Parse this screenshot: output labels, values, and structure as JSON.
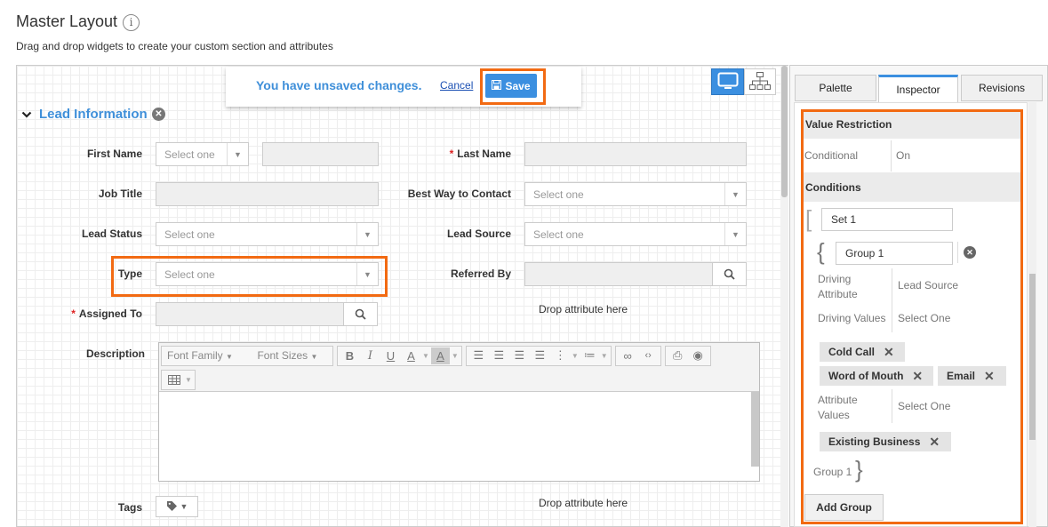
{
  "page": {
    "title": "Master Layout",
    "info_icon": "i",
    "subtitle": "Drag and drop widgets to create your custom section and attributes"
  },
  "notice": {
    "message": "You have unsaved changes.",
    "cancel_label": "Cancel",
    "save_label": "Save"
  },
  "section": {
    "title": "Lead Information"
  },
  "fields": {
    "first_name": {
      "label": "First Name",
      "placeholder": "Select one"
    },
    "last_name": {
      "label": "Last Name"
    },
    "job_title": {
      "label": "Job Title"
    },
    "best_way": {
      "label": "Best Way to Contact",
      "placeholder": "Select one"
    },
    "lead_status": {
      "label": "Lead Status",
      "placeholder": "Select one"
    },
    "lead_source": {
      "label": "Lead Source",
      "placeholder": "Select one"
    },
    "type": {
      "label": "Type",
      "placeholder": "Select one"
    },
    "referred_by": {
      "label": "Referred By"
    },
    "assigned_to": {
      "label": "Assigned To"
    },
    "description": {
      "label": "Description"
    },
    "tags": {
      "label": "Tags"
    },
    "required_mark": "*",
    "drop_1": "Drop attribute here",
    "drop_2": "Drop attribute here"
  },
  "editor": {
    "font_family": "Font Family",
    "font_sizes": "Font Sizes",
    "bold": "B",
    "italic": "I",
    "underline": "U",
    "font_color": "A",
    "bg_color": "A"
  },
  "panel": {
    "tabs": [
      "Palette",
      "Inspector",
      "Revisions"
    ],
    "value_restriction": "Value Restriction",
    "conditional_label": "Conditional",
    "conditional_value": "On",
    "conditions": "Conditions",
    "set_name": "Set 1",
    "group_name": "Group 1",
    "driving_attribute_label": "Driving Attribute",
    "driving_attribute_value": "Lead Source",
    "driving_values_label": "Driving Values",
    "driving_values_placeholder": "Select One",
    "driving_chips": [
      "Cold Call",
      "Word of Mouth",
      "Email"
    ],
    "attribute_values_label": "Attribute Values",
    "attribute_values_placeholder": "Select One",
    "attribute_chips": [
      "Existing Business"
    ],
    "group_close_label": "Group 1",
    "add_group": "Add Group"
  },
  "colors": {
    "accent": "#3b8fe0",
    "highlight": "#f26a12",
    "required": "#dd2222"
  }
}
